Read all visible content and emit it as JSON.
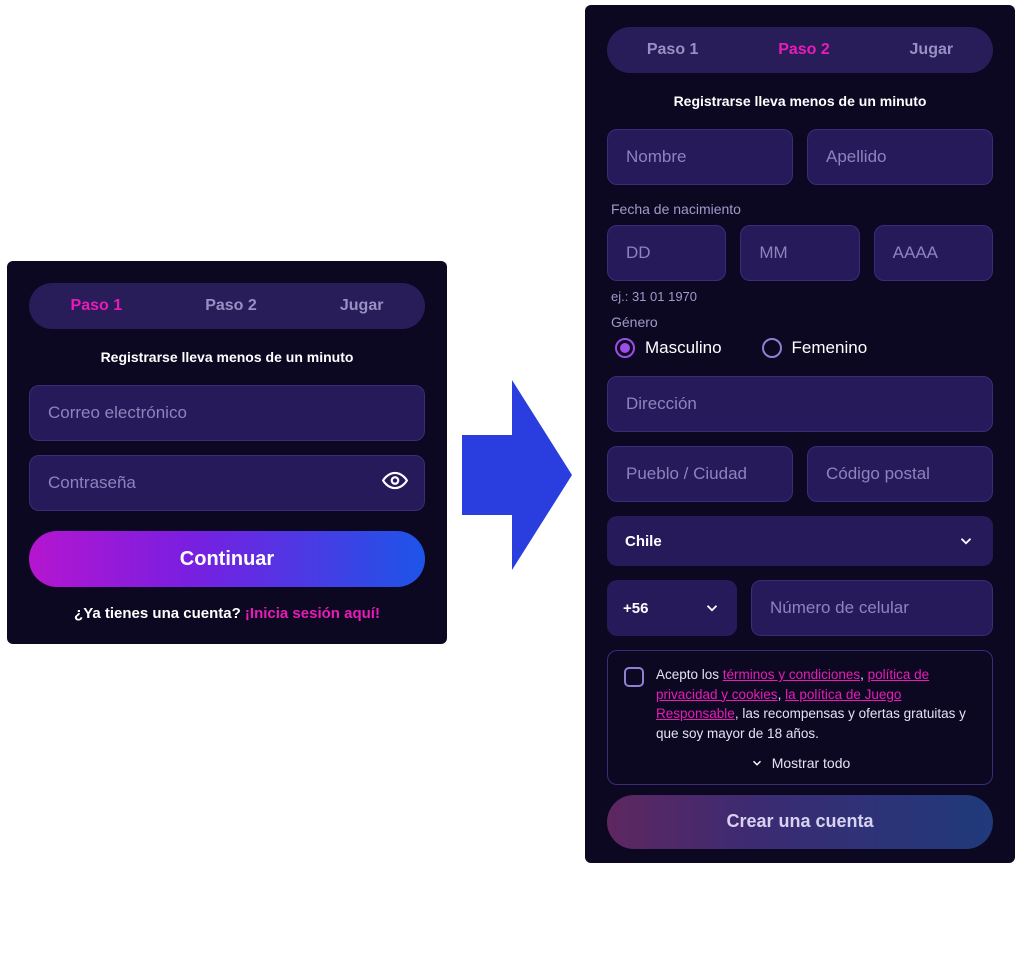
{
  "left": {
    "tabs": [
      "Paso 1",
      "Paso 2",
      "Jugar"
    ],
    "active_tab_index": 0,
    "subtitle": "Registrarse lleva menos de un minuto",
    "email_placeholder": "Correo electrónico",
    "password_placeholder": "Contraseña",
    "continue_label": "Continuar",
    "have_account_text": "¿Ya tienes una cuenta? ",
    "login_link_text": "¡Inicia sesión aquí!"
  },
  "right": {
    "tabs": [
      "Paso 1",
      "Paso 2",
      "Jugar"
    ],
    "active_tab_index": 1,
    "subtitle": "Registrarse lleva menos de un minuto",
    "first_name_placeholder": "Nombre",
    "last_name_placeholder": "Apellido",
    "dob_label": "Fecha de nacimiento",
    "dob_day_placeholder": "DD",
    "dob_month_placeholder": "MM",
    "dob_year_placeholder": "AAAA",
    "dob_hint": "ej.: 31 01 1970",
    "gender_label": "Género",
    "gender_options": [
      "Masculino",
      "Femenino"
    ],
    "gender_selected_index": 0,
    "address_placeholder": "Dirección",
    "city_placeholder": "Pueblo / Ciudad",
    "postal_placeholder": "Código postal",
    "country_selected": "Chile",
    "phone_code_selected": "+56",
    "phone_placeholder": "Número de celular",
    "terms_prefix": "Acepto los ",
    "terms_link_terms": "términos y condiciones",
    "terms_sep1": ", ",
    "terms_link_privacy": "política de privacidad y cookies",
    "terms_sep2": ", ",
    "terms_link_responsible": "la política de Juego Responsable",
    "terms_suffix": ", las recompensas y ofertas gratuitas y que soy mayor de 18 años.",
    "show_all_label": "Mostrar todo",
    "create_account_label": "Crear una cuenta"
  }
}
